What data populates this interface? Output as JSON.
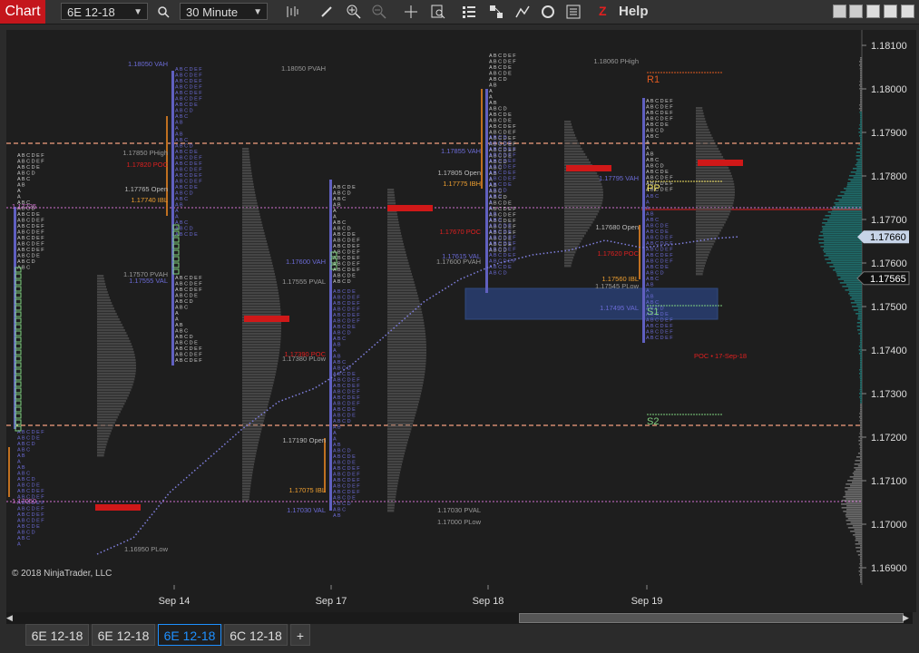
{
  "toolbar": {
    "chart_label": "Chart",
    "instrument": "6E 12-18",
    "interval": "30 Minute",
    "help_label": "Help",
    "help_glyph": "Z"
  },
  "price_axis": {
    "ticks": [
      "1.18100",
      "1.18000",
      "1.17900",
      "1.17800",
      "1.17700",
      "1.17600",
      "1.17500",
      "1.17400",
      "1.17300",
      "1.17200",
      "1.17100",
      "1.17000",
      "1.16900"
    ],
    "current_price": "1.17660",
    "secondary_price": "1.17565"
  },
  "time_axis": {
    "ticks": [
      "Sep 14",
      "Sep 17",
      "Sep 18",
      "Sep 19"
    ]
  },
  "copyright": "© 2018 NinjaTrader, LLC",
  "annotations": [
    {
      "text": "1.18050 VAH",
      "color": "#6b6bd6"
    },
    {
      "text": "1.17850 PHigh",
      "color": "#999"
    },
    {
      "text": "1.17820 POC",
      "color": "#e02020"
    },
    {
      "text": "1.17765 Open",
      "color": "#bbb"
    },
    {
      "text": "1.17740 IBL",
      "color": "#f0a030"
    },
    {
      "text": "1.17725",
      "color": "#d070d0"
    },
    {
      "text": "1.17570 PVAH",
      "color": "#999"
    },
    {
      "text": "1.17555 VAL",
      "color": "#6b6bd6"
    },
    {
      "text": "1.17050",
      "color": "#d070d0"
    },
    {
      "text": "1.16950 PLow",
      "color": "#999"
    },
    {
      "text": "1.18050 PVAH",
      "color": "#999"
    },
    {
      "text": "1.17600 VAH",
      "color": "#6b6bd6"
    },
    {
      "text": "1.17555 PVAL",
      "color": "#999"
    },
    {
      "text": "1.17390 POC",
      "color": "#e02020"
    },
    {
      "text": "1.17380 PLow",
      "color": "#999"
    },
    {
      "text": "1.17190 Open",
      "color": "#bbb"
    },
    {
      "text": "1.17075 IBL",
      "color": "#f0a030"
    },
    {
      "text": "1.17030 VAL",
      "color": "#6b6bd6"
    },
    {
      "text": "1.17855 VAH",
      "color": "#6b6bd6"
    },
    {
      "text": "1.17805 Open",
      "color": "#bbb"
    },
    {
      "text": "1.17775 IBH",
      "color": "#f0a030"
    },
    {
      "text": "1.17670 POC",
      "color": "#e02020"
    },
    {
      "text": "1.17615 VAL",
      "color": "#6b6bd6"
    },
    {
      "text": "1.17600 PVAH",
      "color": "#999"
    },
    {
      "text": "1.17030 PVAL",
      "color": "#999"
    },
    {
      "text": "1.17000 PLow",
      "color": "#999"
    },
    {
      "text": "1.18060 PHigh",
      "color": "#999"
    },
    {
      "text": "1.17795 VAH",
      "color": "#6b6bd6"
    },
    {
      "text": "1.17680 Open",
      "color": "#bbb"
    },
    {
      "text": "1.17620 POC",
      "color": "#e02020"
    },
    {
      "text": "1.17560 IBL",
      "color": "#f0a030"
    },
    {
      "text": "1.17545 PLow",
      "color": "#999"
    },
    {
      "text": "1.17495 VAL",
      "color": "#6b6bd6"
    },
    {
      "text": "POC • 17-Sep-18",
      "color": "#e02020"
    }
  ],
  "pivots": [
    "R1",
    "PP",
    "S1",
    "S2"
  ],
  "tabs": [
    "6E 12-18",
    "6E 12-18",
    "6E 12-18",
    "6C 12-18"
  ],
  "active_tab": 2,
  "add_tab": "+"
}
